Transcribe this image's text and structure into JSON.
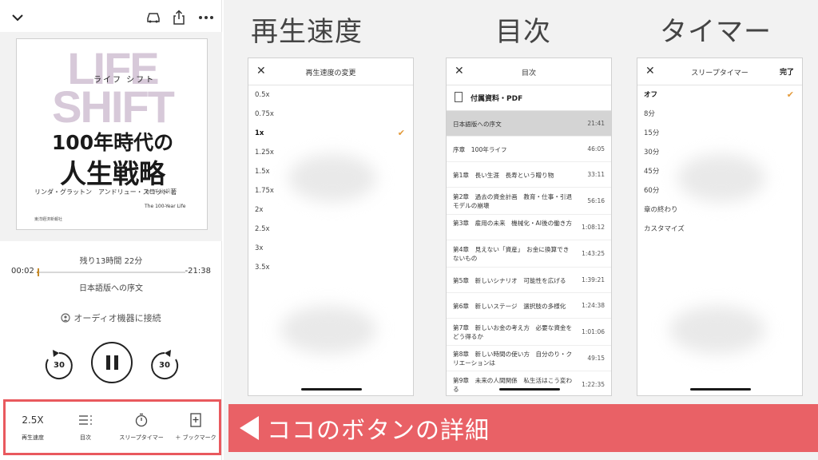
{
  "player": {
    "cover": {
      "line1": "LIFE",
      "line2": "SHIFT",
      "ruby": "ライフ シフト",
      "title1": "100年時代の",
      "title2": "人生戦略",
      "authors": "リンダ・グラットン　アンドリュー・スコット 著",
      "translator": "池村千秋 訳",
      "english": "The 100-Year Life",
      "publisher": "東洋経済新報社"
    },
    "remaining": "残り13時間 22分",
    "elapsed": "00:02",
    "time_left": "-21:38",
    "progress": 0.01,
    "current_chapter": "日本語版への序文",
    "connect_label": "オーディオ機器に接続",
    "skip_back": "30",
    "skip_forward": "30",
    "bottom": {
      "speed_value": "2.5X",
      "speed_label": "再生速度",
      "toc_label": "目次",
      "timer_label": "スリープタイマー",
      "bookmark_label": "＋ ブックマーク"
    }
  },
  "headings": {
    "speed": "再生速度",
    "toc": "目次",
    "timer": "タイマー"
  },
  "speed_panel": {
    "title": "再生速度の変更",
    "options": [
      "0.5x",
      "0.75x",
      "1x",
      "1.25x",
      "1.5x",
      "1.75x",
      "2x",
      "2.5x",
      "3x",
      "3.5x"
    ],
    "selected_index": 2
  },
  "toc_panel": {
    "title": "目次",
    "file_item": "付属資料・PDF",
    "chapters": [
      {
        "title": "日本語版への序文",
        "time": "21:41"
      },
      {
        "title": "序章　100年ライフ",
        "time": "46:05"
      },
      {
        "title": "第1章　長い生涯　長寿という贈り物",
        "time": "33:11"
      },
      {
        "title": "第2章　過去の資金計画　教育・仕事・引退モデルの崩壊",
        "time": "56:16"
      },
      {
        "title": "第3章　雇用の未来　機械化・AI後の働き方",
        "time": "1:08:12"
      },
      {
        "title": "第4章　見えない「資産」　お金に換算できないもの",
        "time": "1:43:25"
      },
      {
        "title": "第5章　新しいシナリオ　可能性を広げる",
        "time": "1:39:21"
      },
      {
        "title": "第6章　新しいステージ　選択肢の多様化",
        "time": "1:24:38"
      },
      {
        "title": "第7章　新しいお金の考え方　必要な資金をどう得るか",
        "time": "1:01:06"
      },
      {
        "title": "第8章　新しい時間の使い方　自分のり・クリエーションは",
        "time": "49:15"
      },
      {
        "title": "第9章　未来の人間関係　私生活はこう変わる",
        "time": "1:22:35"
      }
    ]
  },
  "timer_panel": {
    "title": "スリープタイマー",
    "done_label": "完了",
    "options": [
      "オフ",
      "8分",
      "15分",
      "30分",
      "45分",
      "60分",
      "章の終わり",
      "カスタマイズ"
    ],
    "selected_index": 0
  },
  "banner": {
    "text": "ココのボタンの詳細"
  },
  "colors": {
    "accent": "#e96166",
    "check": "#e39a3a",
    "progress": "#c58a2a"
  }
}
